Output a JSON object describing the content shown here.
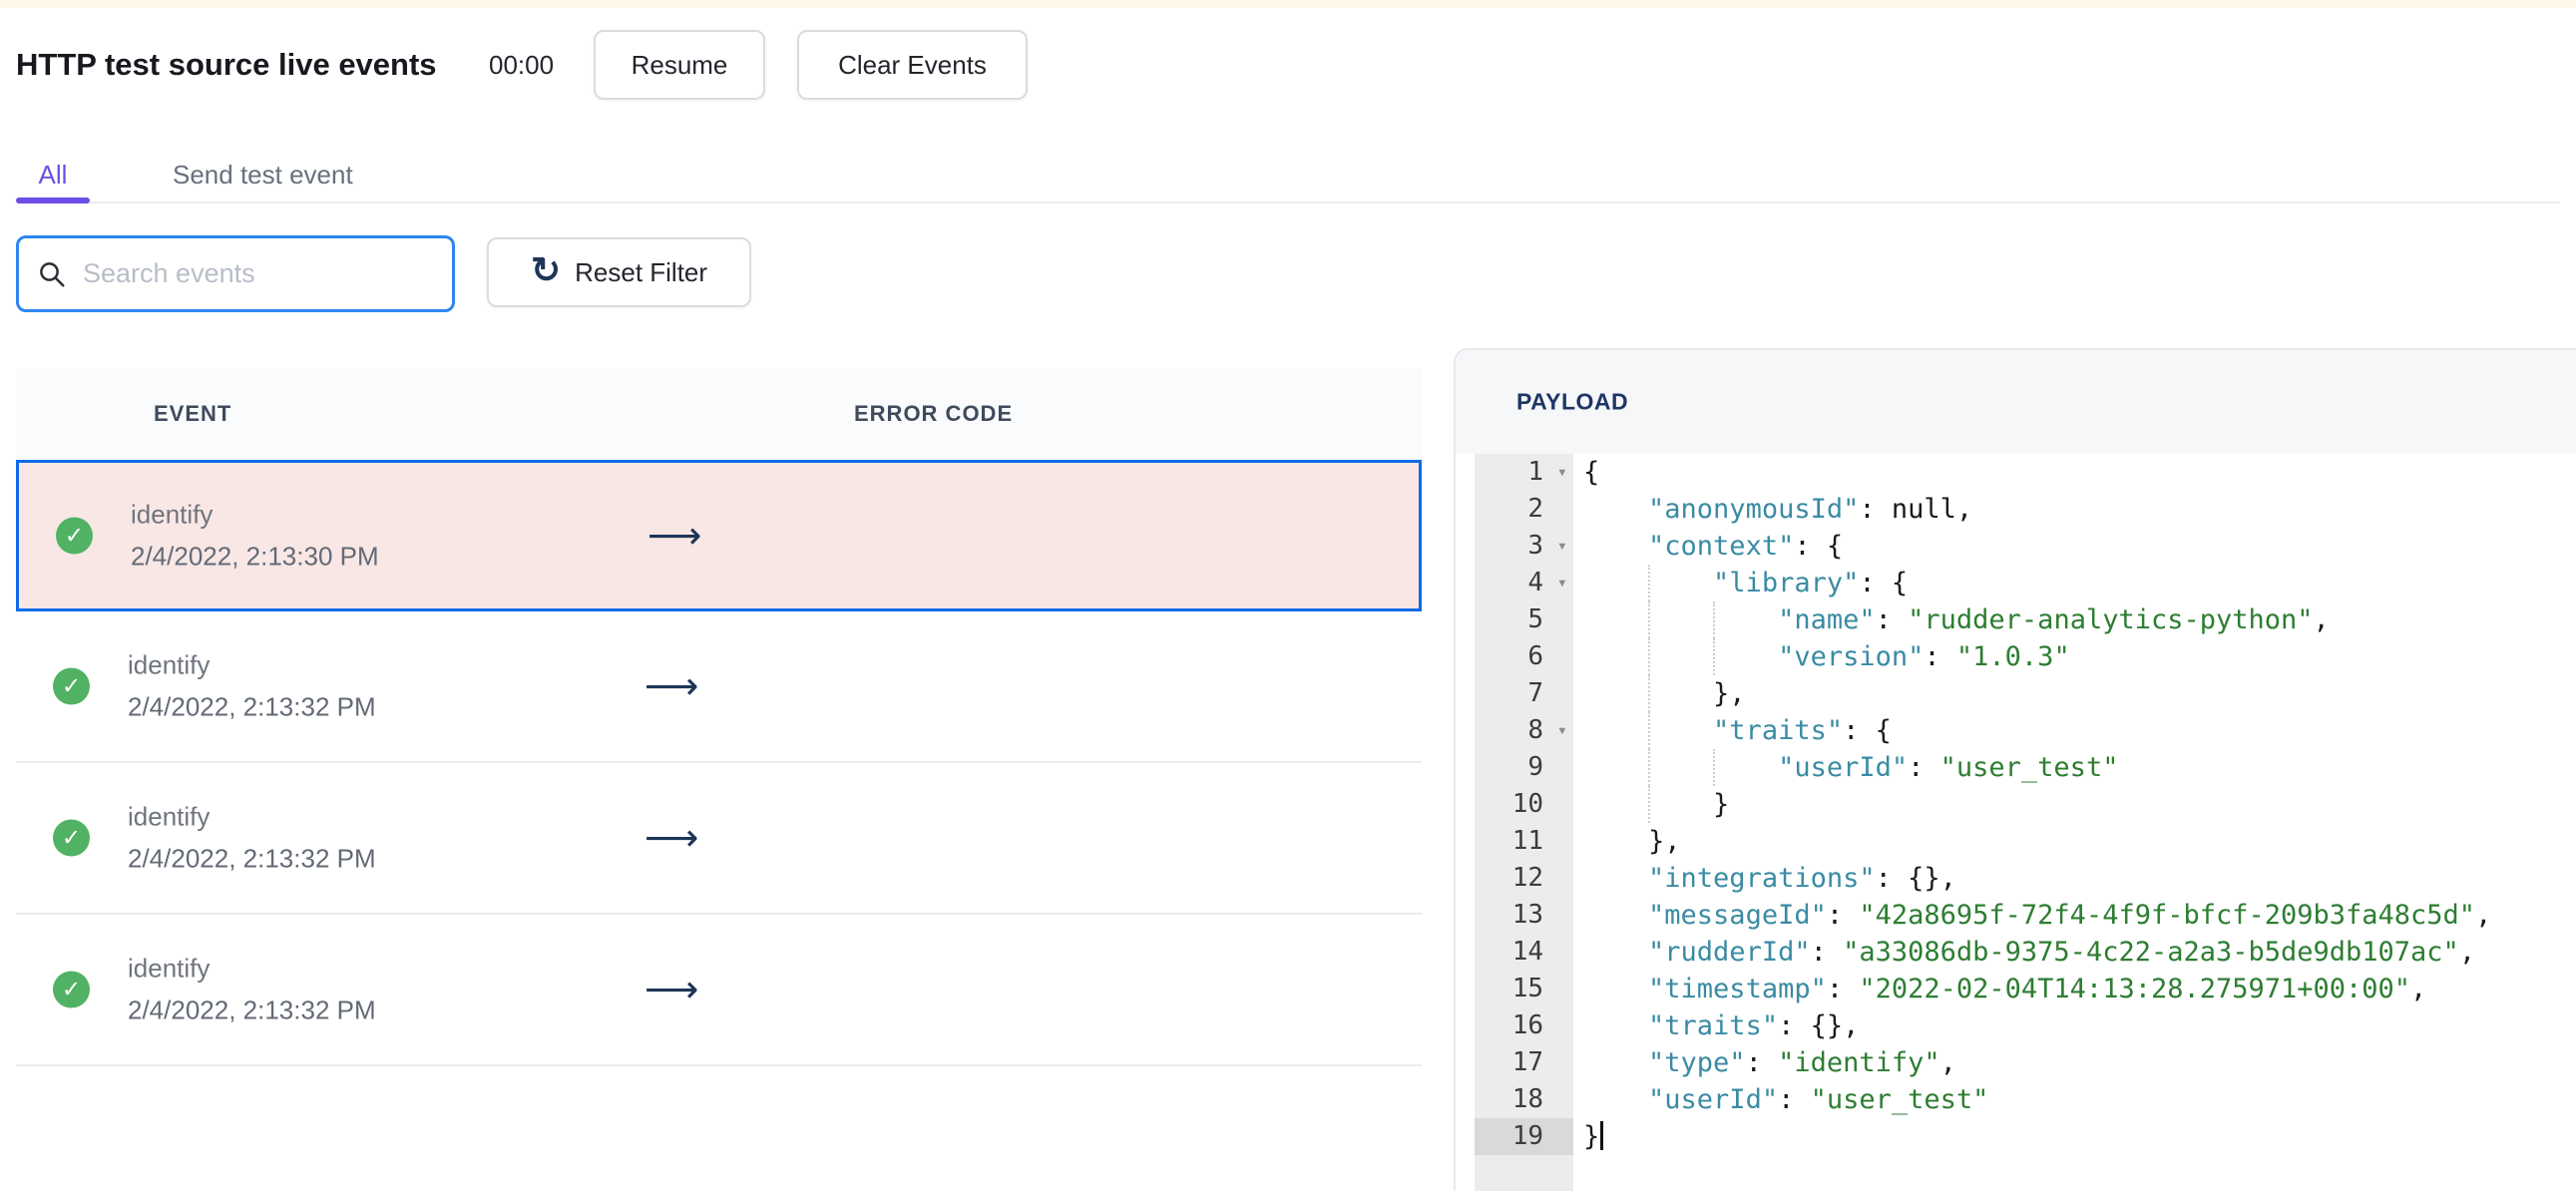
{
  "page": {
    "title": "HTTP test source live events",
    "timer": "00:00"
  },
  "toolbar": {
    "resume_label": "Resume",
    "clear_label": "Clear Events"
  },
  "tabs": [
    {
      "label": "All",
      "active": true
    },
    {
      "label": "Send test event",
      "active": false
    }
  ],
  "filters": {
    "search_placeholder": "Search events",
    "search_icon": "search-icon",
    "reset_label": "Reset Filter",
    "reset_icon": {
      "name": "refresh-icon",
      "glyph": "↻"
    }
  },
  "events_table": {
    "columns": [
      "EVENT",
      "ERROR CODE"
    ],
    "status_icon": {
      "name": "check-circle-icon",
      "glyph": "✓"
    },
    "arrow_icon": {
      "name": "long-arrow-right-icon",
      "glyph": "⟶"
    },
    "rows": [
      {
        "event": "identify",
        "timestamp": "2/4/2022, 2:13:30 PM",
        "status": "success",
        "selected": true
      },
      {
        "event": "identify",
        "timestamp": "2/4/2022, 2:13:32 PM",
        "status": "success",
        "selected": false
      },
      {
        "event": "identify",
        "timestamp": "2/4/2022, 2:13:32 PM",
        "status": "success",
        "selected": false
      },
      {
        "event": "identify",
        "timestamp": "2/4/2022, 2:13:32 PM",
        "status": "success",
        "selected": false
      }
    ]
  },
  "payload_panel": {
    "title": "PAYLOAD",
    "active_line": 19,
    "collapse_icon": {
      "name": "collapse-caret-icon",
      "glyph": "▾"
    },
    "lines": [
      {
        "num": 1,
        "collapsible": true,
        "tokens": [
          {
            "type": "plain",
            "text": "{"
          }
        ]
      },
      {
        "num": 2,
        "tokens": [
          {
            "type": "plain",
            "text": "    "
          },
          {
            "type": "key",
            "text": "\"anonymousId\""
          },
          {
            "type": "plain",
            "text": ": null,"
          }
        ]
      },
      {
        "num": 3,
        "collapsible": true,
        "tokens": [
          {
            "type": "plain",
            "text": "    "
          },
          {
            "type": "key",
            "text": "\"context\""
          },
          {
            "type": "plain",
            "text": ": {"
          }
        ]
      },
      {
        "num": 4,
        "collapsible": true,
        "guides": [
          65
        ],
        "tokens": [
          {
            "type": "plain",
            "text": "        "
          },
          {
            "type": "key",
            "text": "\"library\""
          },
          {
            "type": "plain",
            "text": ": {"
          }
        ]
      },
      {
        "num": 5,
        "guides": [
          65,
          130
        ],
        "tokens": [
          {
            "type": "plain",
            "text": "            "
          },
          {
            "type": "key",
            "text": "\"name\""
          },
          {
            "type": "plain",
            "text": ": "
          },
          {
            "type": "string",
            "text": "\"rudder-analytics-python\""
          },
          {
            "type": "plain",
            "text": ","
          }
        ]
      },
      {
        "num": 6,
        "guides": [
          65,
          130
        ],
        "tokens": [
          {
            "type": "plain",
            "text": "            "
          },
          {
            "type": "key",
            "text": "\"version\""
          },
          {
            "type": "plain",
            "text": ": "
          },
          {
            "type": "string",
            "text": "\"1.0.3\""
          }
        ]
      },
      {
        "num": 7,
        "guides": [
          65
        ],
        "tokens": [
          {
            "type": "plain",
            "text": "        },"
          }
        ]
      },
      {
        "num": 8,
        "collapsible": true,
        "guides": [
          65
        ],
        "tokens": [
          {
            "type": "plain",
            "text": "        "
          },
          {
            "type": "key",
            "text": "\"traits\""
          },
          {
            "type": "plain",
            "text": ": {"
          }
        ]
      },
      {
        "num": 9,
        "guides": [
          65,
          130
        ],
        "tokens": [
          {
            "type": "plain",
            "text": "            "
          },
          {
            "type": "key",
            "text": "\"userId\""
          },
          {
            "type": "plain",
            "text": ": "
          },
          {
            "type": "string",
            "text": "\"user_test\""
          }
        ]
      },
      {
        "num": 10,
        "guides": [
          65
        ],
        "tokens": [
          {
            "type": "plain",
            "text": "        }"
          }
        ]
      },
      {
        "num": 11,
        "tokens": [
          {
            "type": "plain",
            "text": "    },"
          }
        ]
      },
      {
        "num": 12,
        "tokens": [
          {
            "type": "plain",
            "text": "    "
          },
          {
            "type": "key",
            "text": "\"integrations\""
          },
          {
            "type": "plain",
            "text": ": {},"
          }
        ]
      },
      {
        "num": 13,
        "tokens": [
          {
            "type": "plain",
            "text": "    "
          },
          {
            "type": "key",
            "text": "\"messageId\""
          },
          {
            "type": "plain",
            "text": ": "
          },
          {
            "type": "string",
            "text": "\"42a8695f-72f4-4f9f-bfcf-209b3fa48c5d\""
          },
          {
            "type": "plain",
            "text": ","
          }
        ]
      },
      {
        "num": 14,
        "tokens": [
          {
            "type": "plain",
            "text": "    "
          },
          {
            "type": "key",
            "text": "\"rudderId\""
          },
          {
            "type": "plain",
            "text": ": "
          },
          {
            "type": "string",
            "text": "\"a33086db-9375-4c22-a2a3-b5de9db107ac\""
          },
          {
            "type": "plain",
            "text": ","
          }
        ]
      },
      {
        "num": 15,
        "tokens": [
          {
            "type": "plain",
            "text": "    "
          },
          {
            "type": "key",
            "text": "\"timestamp\""
          },
          {
            "type": "plain",
            "text": ": "
          },
          {
            "type": "string",
            "text": "\"2022-02-04T14:13:28.275971+00:00\""
          },
          {
            "type": "plain",
            "text": ","
          }
        ]
      },
      {
        "num": 16,
        "tokens": [
          {
            "type": "plain",
            "text": "    "
          },
          {
            "type": "key",
            "text": "\"traits\""
          },
          {
            "type": "plain",
            "text": ": {},"
          }
        ]
      },
      {
        "num": 17,
        "tokens": [
          {
            "type": "plain",
            "text": "    "
          },
          {
            "type": "key",
            "text": "\"type\""
          },
          {
            "type": "plain",
            "text": ": "
          },
          {
            "type": "string",
            "text": "\"identify\""
          },
          {
            "type": "plain",
            "text": ","
          }
        ]
      },
      {
        "num": 18,
        "tokens": [
          {
            "type": "plain",
            "text": "    "
          },
          {
            "type": "key",
            "text": "\"userId\""
          },
          {
            "type": "plain",
            "text": ": "
          },
          {
            "type": "string",
            "text": "\"user_test\""
          }
        ]
      },
      {
        "num": 19,
        "cursor": true,
        "tokens": [
          {
            "type": "plain",
            "text": "}"
          }
        ]
      }
    ]
  },
  "colors": {
    "accent_purple": "#6c4ee6",
    "focus_blue": "#2e86f0",
    "selected_border": "#0d6be6",
    "selected_bg": "#f8e7e5",
    "success_green": "#51b264",
    "navy": "#1d3557",
    "payload_title": "#1e3666",
    "json_key": "#3a8ba3",
    "json_string": "#2d7d32",
    "header_text": "#3f4b5d",
    "top_strip": "#fdf7e7"
  }
}
